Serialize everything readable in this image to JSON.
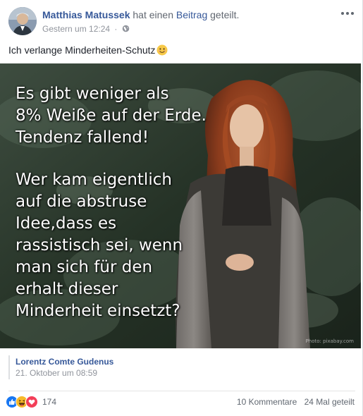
{
  "post": {
    "author": "Matthias Matussek",
    "action_prefix": "hat einen",
    "action_link": "Beitrag",
    "action_suffix": "geteilt.",
    "timestamp": "Gestern um 12:24",
    "separator": "·",
    "text": "Ich verlange Minderheiten-Schutz",
    "privacy_icon": "globe-icon",
    "menu_icon": "more-options-icon"
  },
  "image": {
    "text_block_1": [
      "Es gibt weniger als",
      "8% Weiße auf der Erde.",
      "Tendenz fallend!"
    ],
    "text_block_2": [
      "Wer kam eigentlich",
      "auf die abstruse",
      "Idee,dass es",
      "rassistisch sei, wenn",
      "man sich für den",
      "erhalt dieser",
      "Minderheit einsetzt?"
    ],
    "watermark": "Photo: pixabay.com"
  },
  "shared_from": {
    "name": "Lorentz Comte Gudenus",
    "date": "21. Oktober um 08:59"
  },
  "footer": {
    "reaction_count": "174",
    "reactions": [
      "like",
      "haha",
      "love"
    ],
    "comments": "10 Kommentare",
    "shares": "24 Mal geteilt"
  },
  "colors": {
    "link_blue": "#365899",
    "like_blue": "#1877f2",
    "love_red": "#f33e58",
    "haha_yellow": "#f7b928"
  }
}
